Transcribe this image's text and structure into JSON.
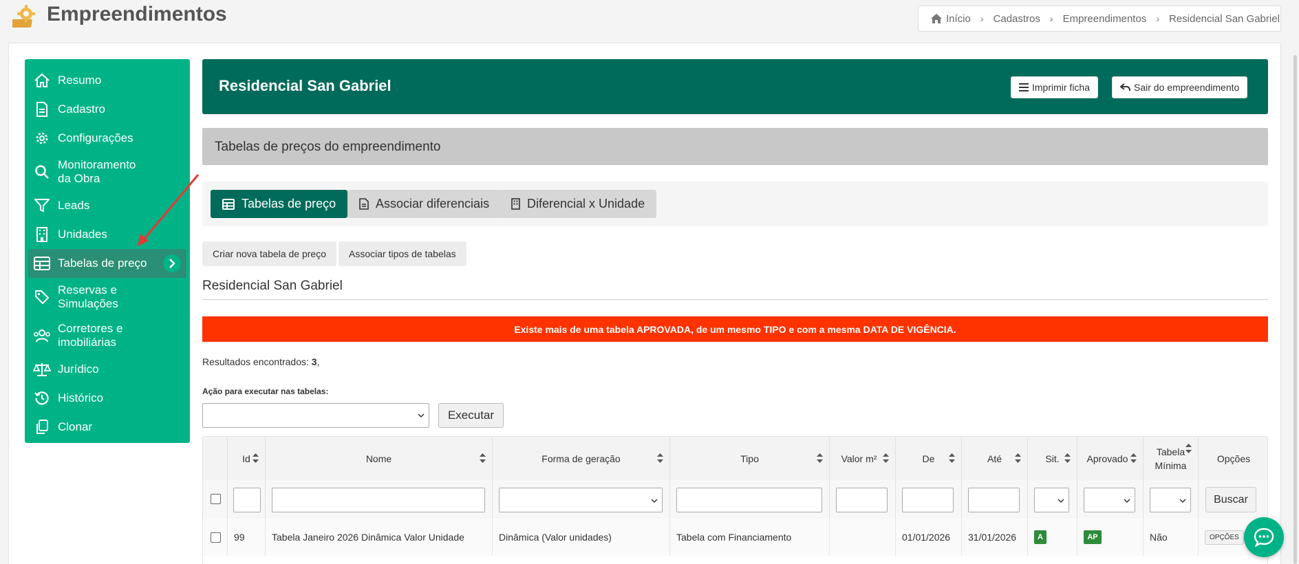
{
  "header": {
    "title": "Empreendimentos",
    "breadcrumb": [
      "Início",
      "Cadastros",
      "Empreendimentos",
      "Residencial San Gabriel"
    ]
  },
  "sidebar": {
    "items": [
      {
        "label": "Resumo",
        "icon": "home-icon"
      },
      {
        "label": "Cadastro",
        "icon": "document-icon"
      },
      {
        "label": "Configurações",
        "icon": "gear-icon"
      },
      {
        "label": "Monitoramento da Obra",
        "icon": "search-icon"
      },
      {
        "label": "Leads",
        "icon": "filter-icon"
      },
      {
        "label": "Unidades",
        "icon": "building-icon"
      },
      {
        "label": "Tabelas de preço",
        "icon": "table-icon",
        "active": true
      },
      {
        "label": "Reservas e Simulações",
        "icon": "tag-icon"
      },
      {
        "label": "Corretores e imobiliárias",
        "icon": "users-icon"
      },
      {
        "label": "Jurídico",
        "icon": "scale-icon"
      },
      {
        "label": "Histórico",
        "icon": "history-icon"
      },
      {
        "label": "Clonar",
        "icon": "copy-icon"
      }
    ]
  },
  "empreendimento": {
    "title": "Residencial San Gabriel",
    "print_label": "Imprimir ficha",
    "exit_label": "Sair do empreendimento"
  },
  "section": {
    "title": "Tabelas de preços do empreendimento"
  },
  "tabs": [
    {
      "label": "Tabelas de preço",
      "active": true
    },
    {
      "label": "Associar diferenciais",
      "active": false
    },
    {
      "label": "Diferencial x Unidade",
      "active": false
    }
  ],
  "actions": {
    "create_label": "Criar nova tabela de preço",
    "assoc_label": "Associar tipos de tabelas"
  },
  "subtitle": "Residencial San Gabriel",
  "alert": "Existe mais de uma tabela APROVADA, de um mesmo TIPO e com a mesma DATA DE VIGÊNCIA.",
  "results": {
    "prefix": "Resultados encontrados: ",
    "count": "3",
    "suffix": ","
  },
  "bulk": {
    "label": "Ação para executar nas tabelas:",
    "value": "",
    "exec_label": "Executar"
  },
  "table": {
    "columns": [
      "Id",
      "Nome",
      "Forma de geração",
      "Tipo",
      "Valor m²",
      "De",
      "Até",
      "Sit.",
      "Aprovado",
      "Tabela Mínima",
      "Opções"
    ],
    "search_label": "Buscar",
    "rows": [
      {
        "id": "99",
        "nome": "Tabela Janeiro 2026 Dinâmica Valor Unidade",
        "forma": "Dinâmica (Valor unidades)",
        "tipo": "Tabela com Financiamento",
        "valor_m2": "",
        "de": "01/01/2026",
        "ate": "31/01/2026",
        "sit": "A",
        "aprovado": "AP",
        "minima": "Não",
        "opcoes": "OPÇÕES"
      }
    ]
  },
  "colors": {
    "sidebar": "#00b386",
    "header": "#006b5a",
    "alert": "#ff3300",
    "badge": "#2e8b3a"
  }
}
